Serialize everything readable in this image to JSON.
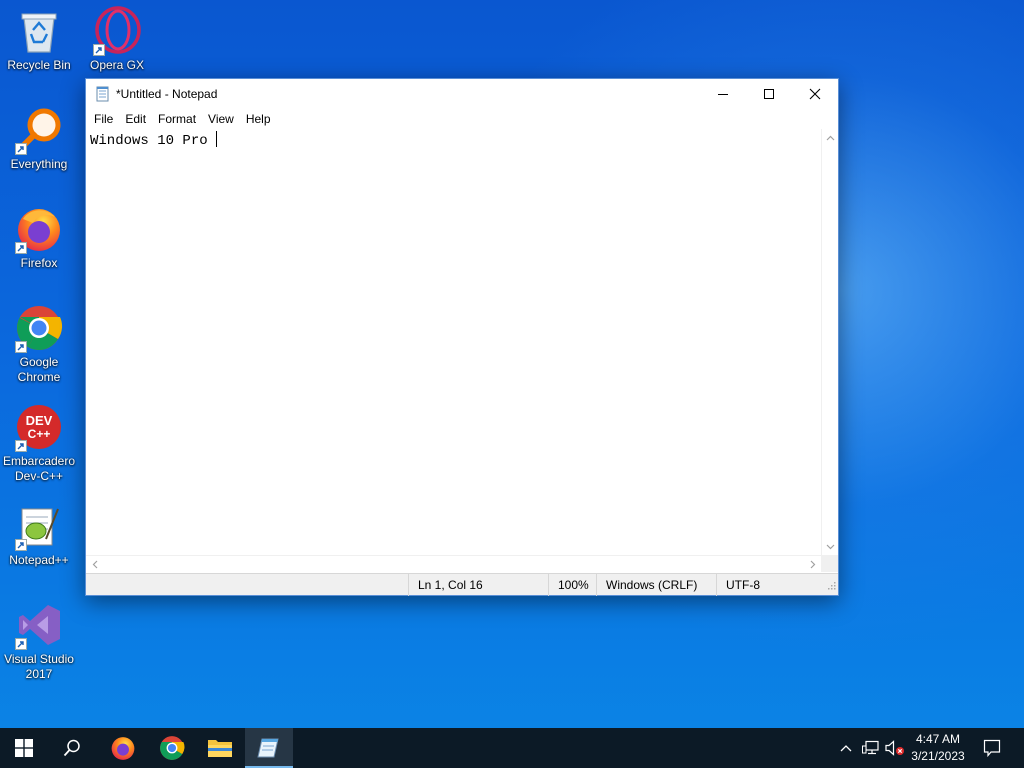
{
  "desktop": {
    "icons": [
      {
        "label": "Recycle Bin"
      },
      {
        "label": "Opera GX"
      },
      {
        "label": "Everything"
      },
      {
        "label": "Firefox"
      },
      {
        "label": "Google Chrome"
      },
      {
        "label": "Embarcadero Dev-C++"
      },
      {
        "label": "Notepad++"
      },
      {
        "label": "Visual Studio 2017"
      }
    ]
  },
  "notepad": {
    "title": "*Untitled - Notepad",
    "menu": [
      "File",
      "Edit",
      "Format",
      "View",
      "Help"
    ],
    "content": "Windows 10 Pro ",
    "status": {
      "position": "Ln 1, Col 16",
      "zoom": "100%",
      "line_endings": "Windows (CRLF)",
      "encoding": "UTF-8"
    }
  },
  "taskbar": {
    "pinned": [
      "start-icon",
      "search-icon",
      "firefox-icon",
      "chrome-icon",
      "file-explorer-icon",
      "notepad-icon"
    ],
    "active": "notepad-icon",
    "clock": {
      "time": "4:47 AM",
      "date": "3/21/2023"
    }
  },
  "colors": {
    "desktop_top": "#0a57d0",
    "desktop_bottom": "#0b86e6",
    "taskbar": "#0c1a26",
    "window_border": "#5a8fd6",
    "status_bar": "#f0f0f0"
  }
}
